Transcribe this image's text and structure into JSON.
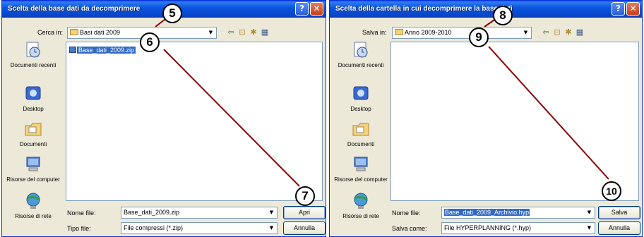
{
  "dialog1": {
    "title": "Scelta della base dati da decomprimere",
    "help": "?",
    "close": "✕",
    "look_in_label": "Cerca in:",
    "look_in_value": "Basi dati 2009",
    "places": [
      "Documenti recenti",
      "Desktop",
      "Documenti",
      "Risorse del computer",
      "Risorse di rete"
    ],
    "file_item": "Base_dati_2009.zip",
    "file_name_label": "Nome file:",
    "file_name_value": "Base_dati_2009.zip",
    "file_type_label": "Tipo file:",
    "file_type_value": "File compressi (*.zip)",
    "primary_button": "Apri",
    "cancel_button": "Annulla"
  },
  "dialog2": {
    "title": "Scelta della cartella in cui decomprimere la base dati",
    "help": "?",
    "close": "✕",
    "look_in_label": "Salva in:",
    "look_in_value": "Anno 2009-2010",
    "places": [
      "Documenti recenti",
      "Desktop",
      "Documenti",
      "Risorse del computer",
      "Risorse di rete"
    ],
    "file_name_label": "Nome file:",
    "file_name_value": "Base_dati_2009_Archivio.hyp",
    "file_type_label": "Salva come:",
    "file_type_value": "File HYPERPLANNING (*.hyp)",
    "primary_button": "Salva",
    "cancel_button": "Annulla"
  },
  "toolbar_icons": [
    "back-arrow-icon",
    "up-folder-icon",
    "new-folder-icon",
    "view-menu-icon"
  ],
  "markers": [
    "5",
    "6",
    "7",
    "8",
    "9",
    "10"
  ],
  "colors": {
    "titlebar": "#0845c8",
    "annotation_line": "#8b0000",
    "selection": "#316ac5",
    "dialog_bg": "#ece9d8"
  }
}
